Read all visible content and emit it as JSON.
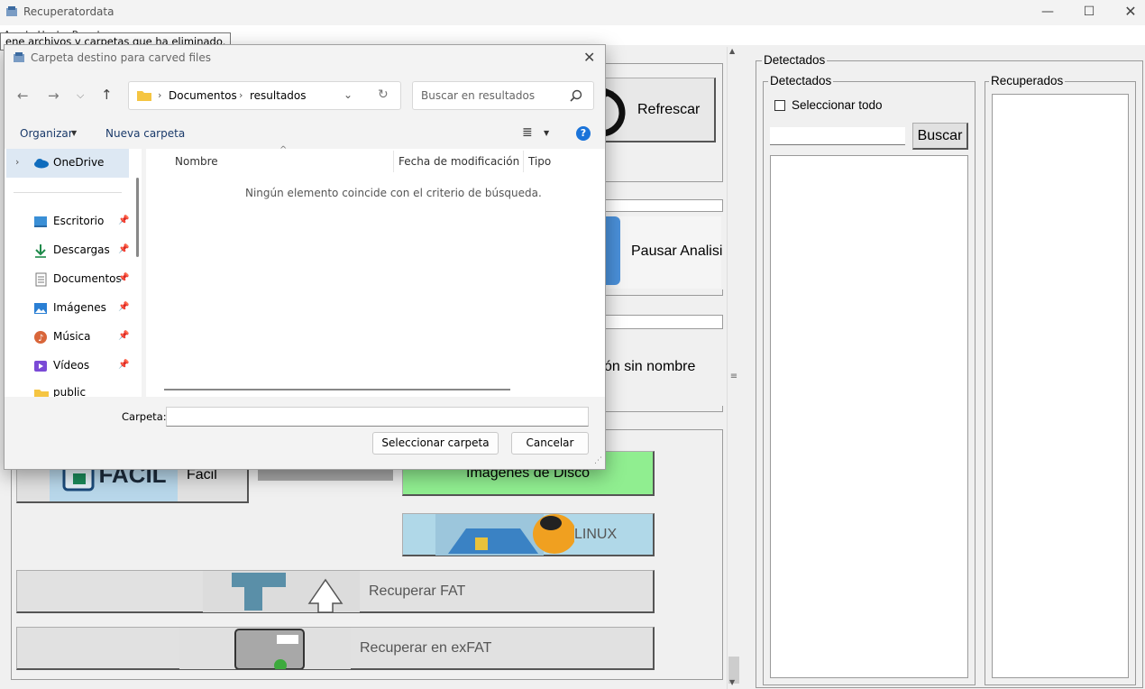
{
  "app": {
    "title": "Recuperatordata",
    "menu_fragment": "Ayuda  Hecho Por el ..."
  },
  "tooltip": "ene archivos y carpetas que ha eliminado.",
  "main": {
    "refresh_button": "Refrescar",
    "pause_button": "Pausar Analisi",
    "unnamed_fragment": "ón sin nombre",
    "easy_label": "Facil",
    "easy_logo_text": "FACIL",
    "disk_images_button": "Imagenes de Disco",
    "linux_button": "LINUX",
    "fat_button": "Recuperar FAT",
    "exfat_button": "Recuperar en exFAT"
  },
  "right_panel": {
    "outer_group": "Detectados",
    "detected_group": "Detectados",
    "select_all": "Seleccionar todo",
    "search_button": "Buscar",
    "search_value": "",
    "recovered_group": "Recuperados"
  },
  "dialog": {
    "title": "Carpeta destino para carved files",
    "breadcrumb": [
      "Documentos",
      "resultados"
    ],
    "search_placeholder": "Buscar en resultados",
    "organize": "Organizar",
    "new_folder": "Nueva carpeta",
    "nav_items": [
      {
        "label": "OneDrive",
        "icon": "cloud-icon"
      },
      {
        "label": "Escritorio",
        "icon": "desktop-icon"
      },
      {
        "label": "Descargas",
        "icon": "download-icon"
      },
      {
        "label": "Documentos",
        "icon": "document-icon"
      },
      {
        "label": "Imágenes",
        "icon": "image-icon"
      },
      {
        "label": "Música",
        "icon": "music-icon"
      },
      {
        "label": "Vídeos",
        "icon": "video-icon"
      },
      {
        "label": "public",
        "icon": "folder-icon"
      }
    ],
    "columns": [
      "Nombre",
      "Fecha de modificación",
      "Tipo"
    ],
    "empty_message": "Ningún elemento coincide con el criterio de búsqueda.",
    "folder_label": "Carpeta:",
    "folder_value": "",
    "select_button": "Seleccionar carpeta",
    "cancel_button": "Cancelar"
  },
  "colors": {
    "accent": "#0067c0",
    "disk_green": "#90ee90",
    "linux_blue": "#b0d8e8",
    "onedrive": "#0f6cbd"
  }
}
